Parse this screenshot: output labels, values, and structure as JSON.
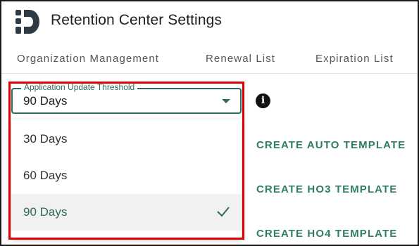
{
  "header": {
    "title": "Retention Center Settings",
    "logo_icon": "d-logo-icon"
  },
  "tabs": [
    {
      "label": "Organization Management"
    },
    {
      "label": "Renewal List"
    },
    {
      "label": "Expiration List"
    }
  ],
  "threshold_select": {
    "label": "Application Update Threshold",
    "value": "90 Days",
    "options": [
      {
        "label": "30 Days",
        "selected": false
      },
      {
        "label": "60 Days",
        "selected": false
      },
      {
        "label": "90 Days",
        "selected": true
      }
    ]
  },
  "info_icon": "info-icon",
  "actions": {
    "auto_template": "CREATE AUTO TEMPLATE",
    "ho3_template": "CREATE HO3 TEMPLATE",
    "ho4_template": "CREATE HO4 TEMPLATE"
  },
  "colors": {
    "accent": "#2e6b59",
    "highlight": "#e00000",
    "selected_bg": "#f1f1f1"
  }
}
